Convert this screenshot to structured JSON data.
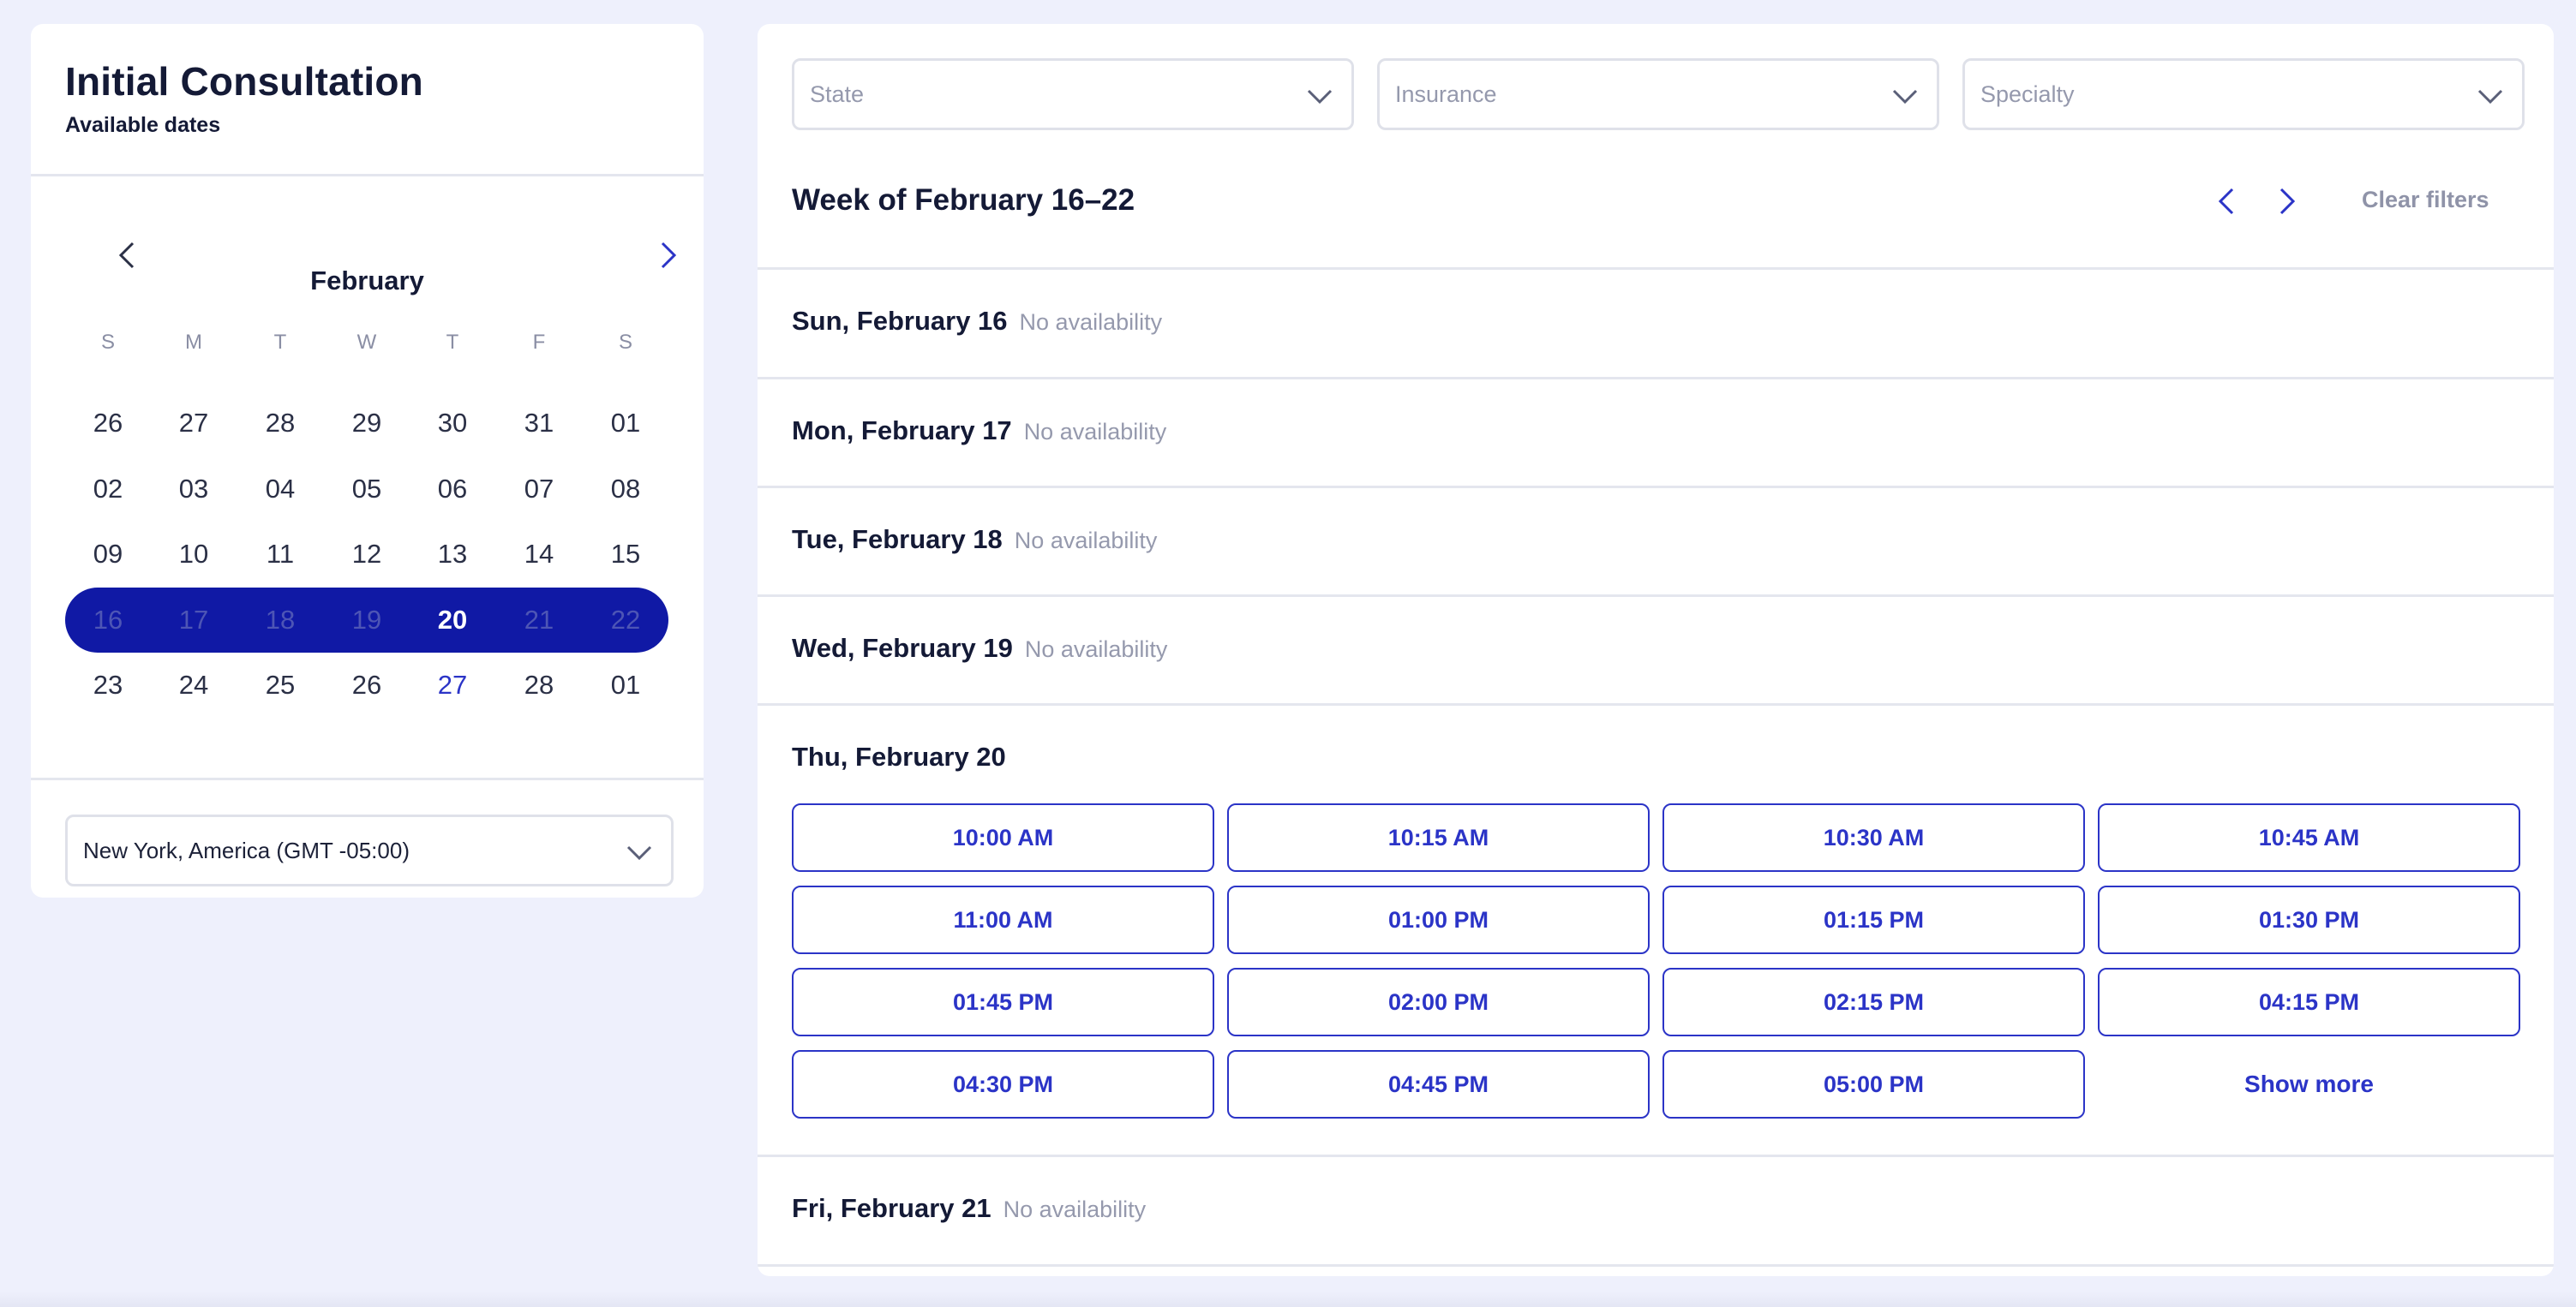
{
  "left_panel": {
    "title": "Initial Consultation",
    "subtitle": "Available dates",
    "calendar": {
      "month": "February",
      "weekdays": [
        "S",
        "M",
        "T",
        "W",
        "T",
        "F",
        "S"
      ],
      "weeks": [
        [
          "26",
          "27",
          "28",
          "29",
          "30",
          "31",
          "01"
        ],
        [
          "02",
          "03",
          "04",
          "05",
          "06",
          "07",
          "08"
        ],
        [
          "09",
          "10",
          "11",
          "12",
          "13",
          "14",
          "15"
        ],
        [
          "16",
          "17",
          "18",
          "19",
          "20",
          "21",
          "22"
        ],
        [
          "23",
          "24",
          "25",
          "26",
          "27",
          "28",
          "01"
        ]
      ],
      "selected_week_index": 3,
      "active_day": "20",
      "today": "27"
    },
    "timezone": "New York, America (GMT -05:00)"
  },
  "filters": {
    "state_placeholder": "State",
    "insurance_placeholder": "Insurance",
    "specialty_placeholder": "Specialty"
  },
  "week": {
    "title": "Week of February 16–22",
    "clear_filters": "Clear filters"
  },
  "days": [
    {
      "label": "Sun, February 16",
      "status": "No availability"
    },
    {
      "label": "Mon, February 17",
      "status": "No availability"
    },
    {
      "label": "Tue, February 18",
      "status": "No availability"
    },
    {
      "label": "Wed, February 19",
      "status": "No availability"
    },
    {
      "label": "Thu, February 20",
      "status": "",
      "slots": [
        "10:00 AM",
        "10:15 AM",
        "10:30 AM",
        "10:45 AM",
        "11:00 AM",
        "01:00 PM",
        "01:15 PM",
        "01:30 PM",
        "01:45 PM",
        "02:00 PM",
        "02:15 PM",
        "04:15 PM",
        "04:30 PM",
        "04:45 PM",
        "05:00 PM"
      ],
      "show_more": "Show more"
    },
    {
      "label": "Fri, February 21",
      "status": "No availability"
    }
  ],
  "colors": {
    "accent": "#2b34c7",
    "selected_week_bg": "#1019a5",
    "page_bg": "#eef0fc",
    "muted_text": "#9599ad"
  }
}
